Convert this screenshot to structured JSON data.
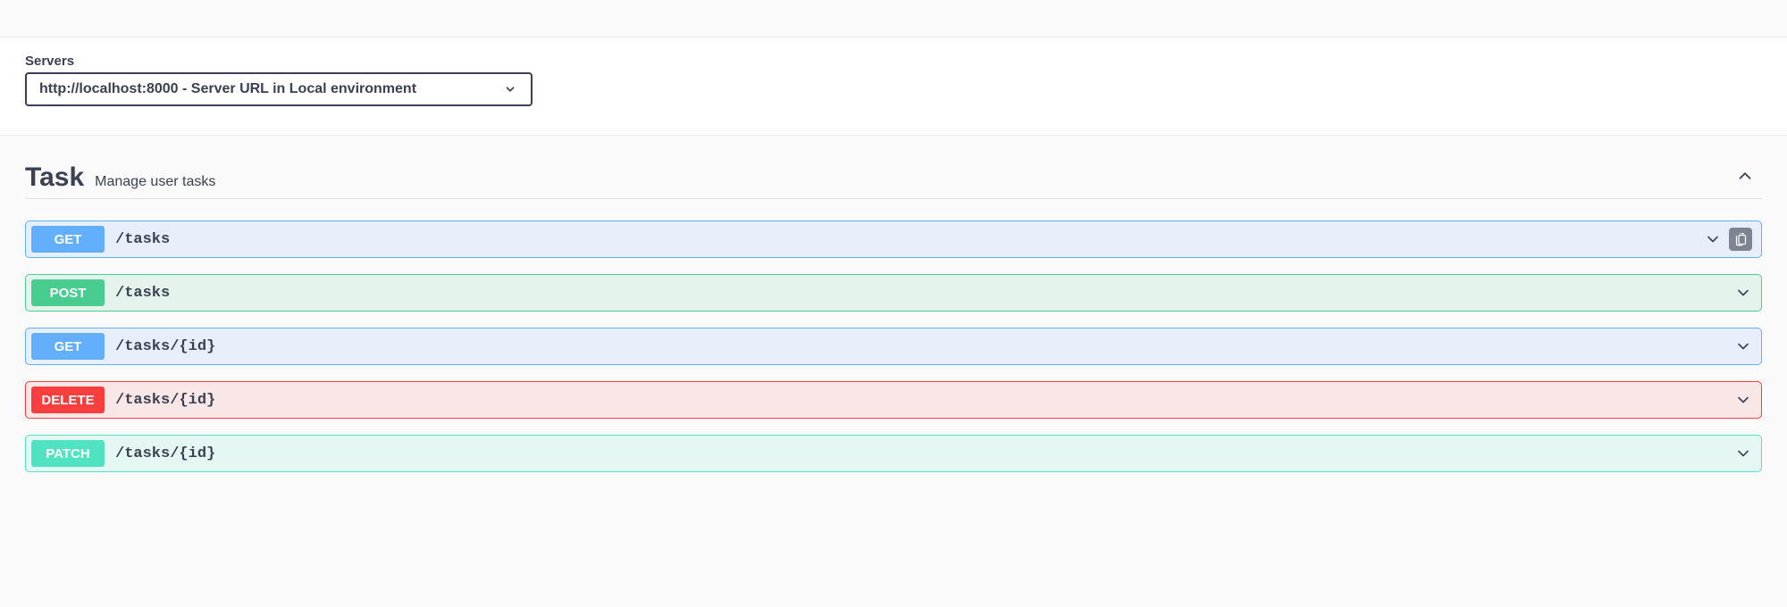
{
  "servers": {
    "label": "Servers",
    "selected": "http://localhost:8000 - Server URL in Local environment"
  },
  "tag": {
    "name": "Task",
    "description": "Manage user tasks",
    "expanded": true
  },
  "operations": [
    {
      "method": "GET",
      "path": "/tasks",
      "style": "get",
      "clipboard": true
    },
    {
      "method": "POST",
      "path": "/tasks",
      "style": "post",
      "clipboard": false
    },
    {
      "method": "GET",
      "path": "/tasks/{id}",
      "style": "get",
      "clipboard": false
    },
    {
      "method": "DELETE",
      "path": "/tasks/{id}",
      "style": "delete",
      "clipboard": false
    },
    {
      "method": "PATCH",
      "path": "/tasks/{id}",
      "style": "patch",
      "clipboard": false
    }
  ],
  "colors": {
    "get": "#61affe",
    "post": "#49cc90",
    "delete": "#f93e3e",
    "patch": "#50e3c2"
  }
}
